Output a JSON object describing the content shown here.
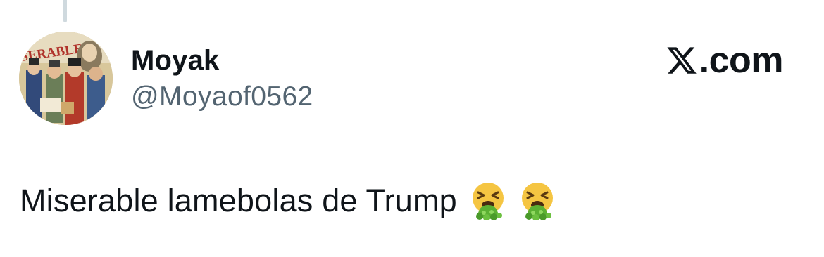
{
  "tweet": {
    "display_name": "Moyak",
    "handle": "@Moyaof0562",
    "text": "Miserable lamebolas de Trump",
    "emojis": [
      "vomiting-face-emoji",
      "vomiting-face-emoji"
    ]
  },
  "brand": {
    "label": ".com",
    "icon": "x-logo-icon"
  },
  "avatar": {
    "icon": "profile-avatar",
    "text": "SERABLES"
  },
  "colors": {
    "text_primary": "#0f1419",
    "text_secondary": "#536471",
    "thread_line": "#cfd9de",
    "emoji_face": "#f5c542",
    "emoji_vomit": "#5bb033"
  }
}
